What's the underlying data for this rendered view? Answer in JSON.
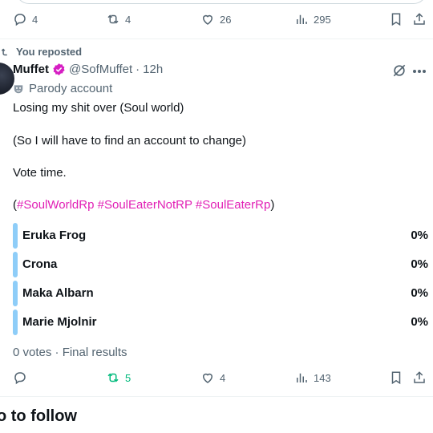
{
  "top_tweet": {
    "reply_count": "4",
    "repost_count": "4",
    "like_count": "26",
    "view_count": "295"
  },
  "repost_context": {
    "label": "You reposted"
  },
  "tweet": {
    "display_name": "Muffet",
    "handle": "@SofMuffet",
    "separator": "·",
    "time": "12h",
    "parody_label": "Parody account",
    "lines": [
      "Losing my shit over (Soul world)",
      "(So I will have to find an account to change)",
      "Vote time."
    ],
    "hashtags": {
      "open_paren": "(",
      "tag1": "#SoulWorldRp",
      "tag2": "#SoulEaterNotRP",
      "tag3": "#SoulEaterRp",
      "close_paren": ")"
    },
    "poll": {
      "options": [
        {
          "label": "Eruka Frog",
          "percent": "0%"
        },
        {
          "label": "Crona",
          "percent": "0%"
        },
        {
          "label": "Maka Albarn",
          "percent": "0%"
        },
        {
          "label": "Marie Mjolnir",
          "percent": "0%"
        }
      ],
      "meta": "0 votes · Final results"
    },
    "reply_count": "",
    "repost_count": "5",
    "like_count": "4",
    "view_count": "143"
  },
  "who_to_follow": {
    "title": "o to follow"
  },
  "colors": {
    "accent_blue": "#1d9bf0",
    "hashtag_pink": "#e11fb5",
    "repost_green": "#00ba7c",
    "poll_bar": "#8ecdf8",
    "verified_pink": "#d61ec3"
  },
  "icons": [
    "reply-icon",
    "repost-icon",
    "like-icon",
    "views-icon",
    "bookmark-icon",
    "share-icon",
    "grok-icon",
    "more-icon",
    "verified-badge-icon",
    "parody-mask-icon"
  ]
}
